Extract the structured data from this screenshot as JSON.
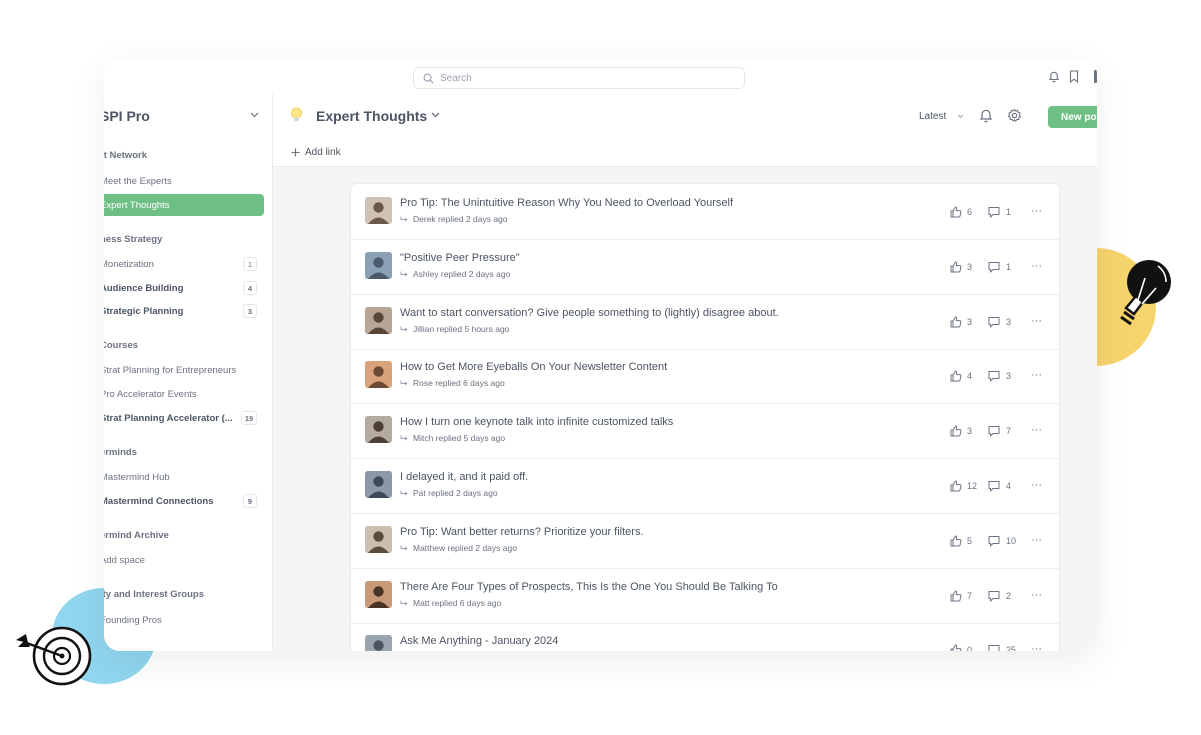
{
  "search": {
    "placeholder": "Search"
  },
  "sidebar": {
    "brand": "SPI Pro",
    "groups": [
      {
        "title": "rt Network",
        "items": [
          {
            "label": "Meet the Experts",
            "count": ""
          },
          {
            "label": "Expert Thoughts",
            "count": "",
            "active": true
          }
        ]
      },
      {
        "title": "ness Strategy",
        "items": [
          {
            "label": "Monetization",
            "count": "1"
          },
          {
            "label": "Audience Building",
            "count": "4"
          },
          {
            "label": "Strategic Planning",
            "count": "3"
          }
        ]
      },
      {
        "title": "Courses",
        "items": [
          {
            "label": "Strat Planning for Entrepreneurs",
            "count": ""
          },
          {
            "label": "Pro Accelerator Events",
            "count": ""
          },
          {
            "label": "Strat Planning Accelerator (...",
            "count": "19"
          }
        ]
      },
      {
        "title": "erminds",
        "items": [
          {
            "label": "Mastermind Hub",
            "count": ""
          },
          {
            "label": "Mastermind Connections",
            "count": "9"
          }
        ]
      },
      {
        "title": "ermind Archive",
        "items": [
          {
            "label": "Add space",
            "count": ""
          }
        ]
      },
      {
        "title": "ity and Interest Groups",
        "items": [
          {
            "label": "Founding Pros",
            "count": ""
          }
        ]
      }
    ]
  },
  "header": {
    "space_title": "Expert Thoughts",
    "sort_label": "Latest",
    "new_post_label": "New po",
    "add_link_label": "Add link"
  },
  "posts": [
    {
      "title": "Pro Tip: The Unintuitive Reason Why You Need to Overload Yourself",
      "meta": "Derek replied 2 days ago",
      "likes": "6",
      "comments": "1"
    },
    {
      "title": "\"Positive Peer Pressure\"",
      "meta": "Ashley replied 2 days ago",
      "likes": "3",
      "comments": "1"
    },
    {
      "title": "Want to start conversation? Give people something to (lightly) disagree about.",
      "meta": "Jillian replied 5 hours ago",
      "likes": "3",
      "comments": "3"
    },
    {
      "title": "How to Get More Eyeballs On Your Newsletter Content",
      "meta": "Rose replied 6 days ago",
      "likes": "4",
      "comments": "3"
    },
    {
      "title": "How I turn one keynote talk into infinite customized talks",
      "meta": "Mitch replied 5 days ago",
      "likes": "3",
      "comments": "7"
    },
    {
      "title": "I delayed it, and it paid off.",
      "meta": "Pat replied 2 days ago",
      "likes": "12",
      "comments": "4"
    },
    {
      "title": "Pro Tip: Want better returns? Prioritize your filters.",
      "meta": "Matthew replied 2 days ago",
      "likes": "5",
      "comments": "10"
    },
    {
      "title": "There Are Four Types of Prospects, This Is the One You Should Be Talking To",
      "meta": "Matt replied 6 days ago",
      "likes": "7",
      "comments": "2"
    },
    {
      "title": "Ask Me Anything - January 2024",
      "meta": "",
      "likes": "0",
      "comments": "25"
    }
  ],
  "colors": {
    "accent": "#6dbf86",
    "deco_yellow": "#f7d36b",
    "deco_blue": "#8fd6ee"
  },
  "icons": [
    "search-icon",
    "bell-icon",
    "bookmark-icon",
    "chevron-down-icon",
    "lightbulb-icon",
    "gear-icon",
    "plus-icon",
    "reply-icon",
    "thumbs-up-icon",
    "comment-icon",
    "more-icon",
    "target-icon"
  ]
}
